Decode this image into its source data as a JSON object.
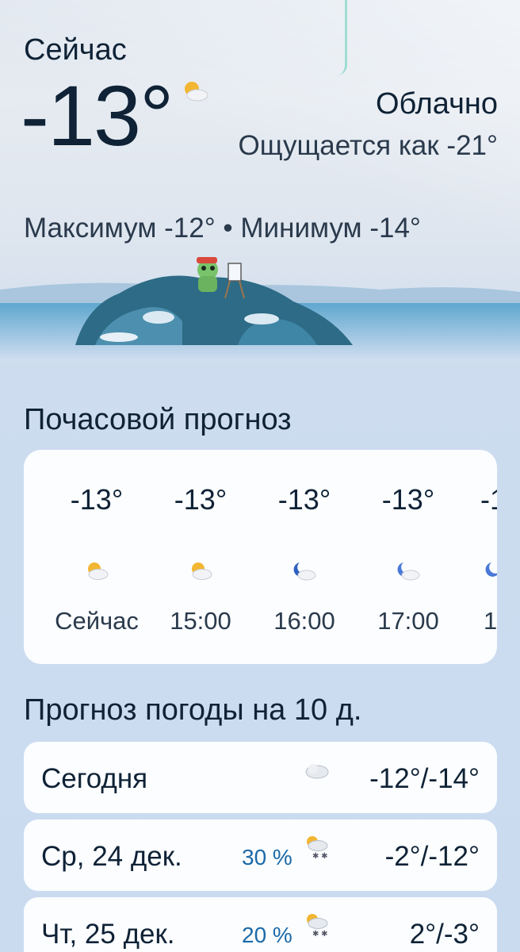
{
  "current": {
    "label": "Сейчас",
    "temp": "-13°",
    "icon": "partly-cloudy-icon",
    "condition": "Облачно",
    "feels_like": "Ощущается как -21°",
    "minmax": "Максимум -12° • Минимум -14°"
  },
  "hourly": {
    "title": "Почасовой прогноз",
    "items": [
      {
        "temp": "-13°",
        "icon": "partly-cloudy-day-icon",
        "time": "Сейчас"
      },
      {
        "temp": "-13°",
        "icon": "partly-cloudy-day-icon",
        "time": "15:00"
      },
      {
        "temp": "-13°",
        "icon": "partly-cloudy-night-icon",
        "time": "16:00"
      },
      {
        "temp": "-13°",
        "icon": "partly-cloudy-night-icon",
        "time": "17:00"
      },
      {
        "temp": "-1",
        "icon": "partly-cloudy-night-icon",
        "time": "1"
      }
    ]
  },
  "daily": {
    "title": "Прогноз погоды на 10 д.",
    "items": [
      {
        "day": "Сегодня",
        "precip": "",
        "icon": "cloudy-icon",
        "temps": "-12°/-14°"
      },
      {
        "day": "Ср, 24 дек.",
        "precip": "30 %",
        "icon": "snow-icon",
        "temps": "-2°/-12°"
      },
      {
        "day": "Чт, 25 дек.",
        "precip": "20 %",
        "icon": "snow-icon",
        "temps": "2°/-3°"
      }
    ]
  },
  "colors": {
    "text": "#0f2236",
    "precip": "#1c6aa8",
    "card": "#fbfdff",
    "background": "#cadbf0"
  }
}
